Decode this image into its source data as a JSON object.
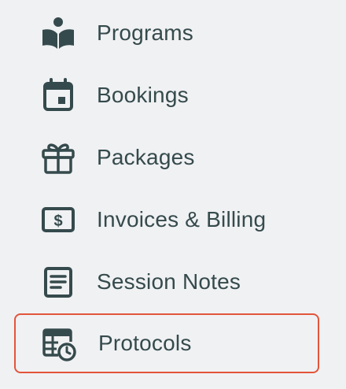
{
  "sidebar": {
    "items": [
      {
        "label": "Programs",
        "icon": "book-reader-icon",
        "active": false
      },
      {
        "label": "Bookings",
        "icon": "calendar-icon",
        "active": false
      },
      {
        "label": "Packages",
        "icon": "gift-icon",
        "active": false
      },
      {
        "label": "Invoices & Billing",
        "icon": "invoice-dollar-icon",
        "active": false
      },
      {
        "label": "Session Notes",
        "icon": "notes-icon",
        "active": false
      },
      {
        "label": "Protocols",
        "icon": "protocol-schedule-icon",
        "active": true
      }
    ]
  },
  "colors": {
    "background": "#f0f1f3",
    "text": "#354a4c",
    "icon": "#354a4c",
    "active_border": "#e2553a",
    "partial_icon": "#3a9a6e"
  }
}
